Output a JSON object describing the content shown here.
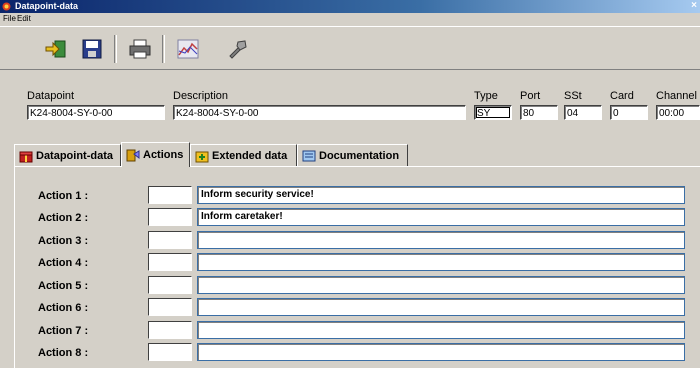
{
  "window": {
    "title": "Datapoint-data"
  },
  "menu": {
    "items": [
      "File",
      "Edit"
    ]
  },
  "toolbar": {
    "icons": [
      "exit-icon",
      "save-icon",
      "print-icon",
      "chart-icon",
      "tools-icon"
    ]
  },
  "header": {
    "fields": [
      {
        "label": "Datapoint",
        "value": "K24-8004-SY-0-00"
      },
      {
        "label": "Description",
        "value": "K24-8004-SY-0-00"
      },
      {
        "label": "Type",
        "value": "SY"
      },
      {
        "label": "Port",
        "value": "80"
      },
      {
        "label": "SSt",
        "value": "04"
      },
      {
        "label": "Card",
        "value": "0"
      },
      {
        "label": "Channel",
        "value": "00:00"
      }
    ]
  },
  "tabs": [
    {
      "label": "Datapoint-data",
      "active": false
    },
    {
      "label": "Actions",
      "active": true
    },
    {
      "label": "Extended data",
      "active": false
    },
    {
      "label": "Documentation",
      "active": false
    }
  ],
  "actions": [
    {
      "label": "Action 1 :",
      "code": "",
      "text": "Inform security service!"
    },
    {
      "label": "Action 2 :",
      "code": "",
      "text": "Inform caretaker!"
    },
    {
      "label": "Action 3 :",
      "code": "",
      "text": ""
    },
    {
      "label": "Action 4 :",
      "code": "",
      "text": ""
    },
    {
      "label": "Action 5 :",
      "code": "",
      "text": ""
    },
    {
      "label": "Action 6 :",
      "code": "",
      "text": ""
    },
    {
      "label": "Action 7 :",
      "code": "",
      "text": ""
    },
    {
      "label": "Action 8 :",
      "code": "",
      "text": ""
    }
  ]
}
